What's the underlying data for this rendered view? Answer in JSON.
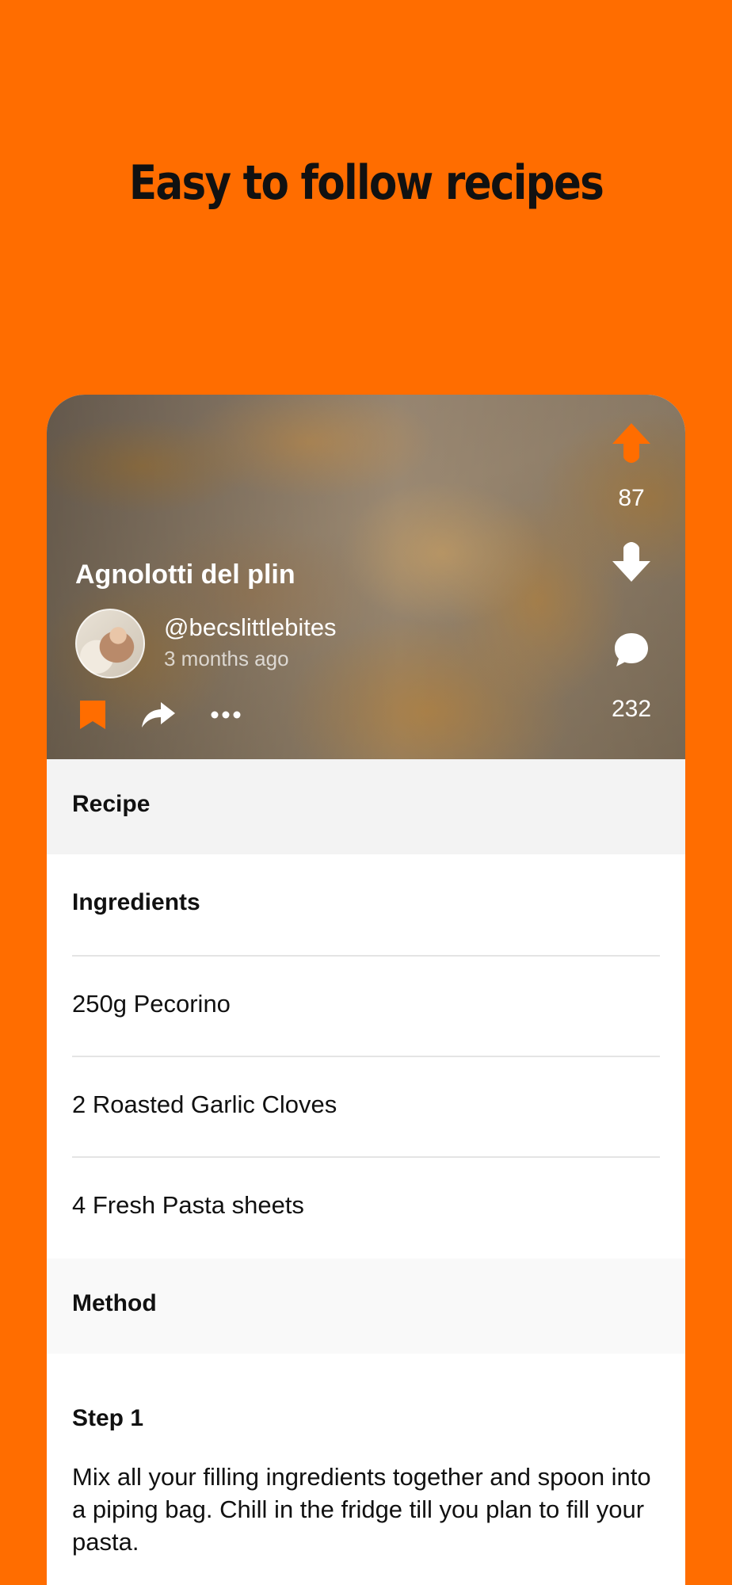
{
  "headline": "Easy to follow recipes",
  "colors": {
    "accent": "#FF6D00",
    "text": "#111111",
    "section_bg": "#F3F3F3"
  },
  "post": {
    "title": "Agnolotti del plin",
    "username": "@becslittlebites",
    "timestamp": "3 months ago",
    "upvotes": "87",
    "comments": "232",
    "icons": [
      "arrow-up-icon",
      "arrow-down-icon",
      "comment-icon",
      "bookmark-icon",
      "share-icon",
      "more-icon"
    ]
  },
  "recipe": {
    "section_label": "Recipe",
    "ingredients_title": "Ingredients",
    "ingredients": [
      "250g Pecorino",
      "2 Roasted Garlic Cloves",
      "4 Fresh Pasta sheets"
    ],
    "method_label": "Method",
    "steps": [
      {
        "title": "Step 1",
        "text": "Mix all your filling ingredients together and spoon into a piping bag. Chill in the fridge till you plan to fill your pasta."
      }
    ]
  }
}
